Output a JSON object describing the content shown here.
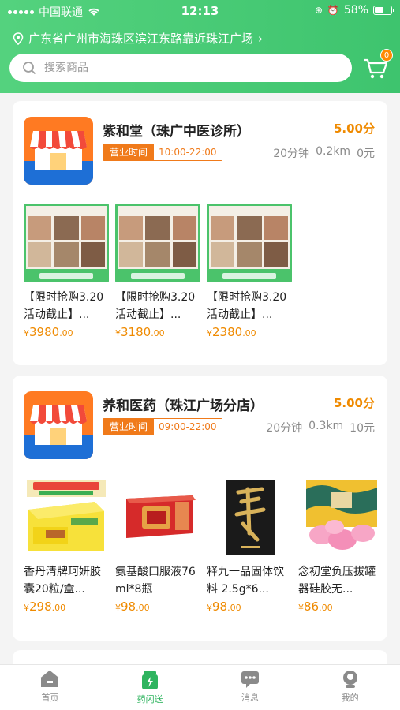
{
  "status_bar": {
    "carrier": "中国联通",
    "time": "12:13",
    "battery": "58%"
  },
  "header": {
    "location": "广东省广州市海珠区滨江东路靠近珠江广场",
    "search_placeholder": "搜索商品",
    "cart_count": "0"
  },
  "colors": {
    "brand_green": "#3ec46e",
    "accent_orange": "#ef8a00"
  },
  "stores": [
    {
      "name": "紫和堂（珠广中医诊所）",
      "score": "5.00分",
      "hours_label": "营业时间",
      "hours": "10:00-22:00",
      "delivery_time": "20分钟",
      "distance": "0.2km",
      "delivery_fee": "0元",
      "products": [
        {
          "name": "【限时抢购3.20活动截止】...",
          "currency": "¥",
          "price_int": "3980",
          "price_dec": ".00"
        },
        {
          "name": "【限时抢购3.20活动截止】...",
          "currency": "¥",
          "price_int": "3180",
          "price_dec": ".00"
        },
        {
          "name": "【限时抢购3.20活动截止】...",
          "currency": "¥",
          "price_int": "2380",
          "price_dec": ".00"
        }
      ]
    },
    {
      "name": "养和医药（珠江广场分店）",
      "score": "5.00分",
      "hours_label": "营业时间",
      "hours": "09:00-22:00",
      "delivery_time": "20分钟",
      "distance": "0.3km",
      "delivery_fee": "10元",
      "products": [
        {
          "name": "香丹清牌珂妍胶囊20粒/盒...",
          "currency": "¥",
          "price_int": "298",
          "price_dec": ".00"
        },
        {
          "name": "氨基酸口服液76ml*8瓶",
          "currency": "¥",
          "price_int": "98",
          "price_dec": ".00"
        },
        {
          "name": "释九一品固体饮料 2.5g*6...",
          "currency": "¥",
          "price_int": "98",
          "price_dec": ".00"
        },
        {
          "name": "念初堂负压拔罐器硅胶无...",
          "currency": "¥",
          "price_int": "86",
          "price_dec": ".00"
        }
      ]
    }
  ],
  "tabbar": [
    {
      "label": "首页",
      "icon": "home-icon"
    },
    {
      "label": "药闪送",
      "icon": "medicine-bag-icon"
    },
    {
      "label": "消息",
      "icon": "message-icon"
    },
    {
      "label": "我的",
      "icon": "profile-icon"
    }
  ]
}
